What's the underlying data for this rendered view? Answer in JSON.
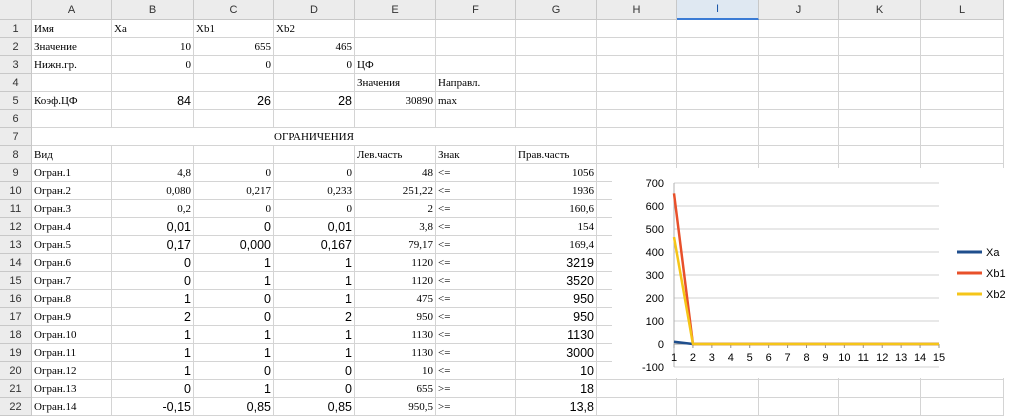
{
  "columns": [
    "A",
    "B",
    "C",
    "D",
    "E",
    "F",
    "G",
    "H",
    "I",
    "J",
    "K",
    "L"
  ],
  "selected_column": "I",
  "rows": [
    {
      "n": "1",
      "cells": [
        {
          "col": 0,
          "v": "Имя"
        },
        {
          "col": 1,
          "v": "Xa"
        },
        {
          "col": 2,
          "v": "Xb1"
        },
        {
          "col": 3,
          "v": "Xb2"
        }
      ]
    },
    {
      "n": "2",
      "cells": [
        {
          "col": 0,
          "v": "Значение"
        },
        {
          "col": 1,
          "v": "10",
          "a": "r"
        },
        {
          "col": 2,
          "v": "655",
          "a": "r"
        },
        {
          "col": 3,
          "v": "465",
          "a": "r"
        }
      ]
    },
    {
      "n": "3",
      "cells": [
        {
          "col": 0,
          "v": "Нижн.гр."
        },
        {
          "col": 1,
          "v": "0",
          "a": "r"
        },
        {
          "col": 2,
          "v": "0",
          "a": "r"
        },
        {
          "col": 3,
          "v": "0",
          "a": "r"
        },
        {
          "col": 4,
          "v": "ЦФ"
        }
      ]
    },
    {
      "n": "4",
      "cells": [
        {
          "col": 4,
          "v": "Значения"
        },
        {
          "col": 5,
          "v": "Направл."
        }
      ]
    },
    {
      "n": "5",
      "cells": [
        {
          "col": 0,
          "v": "Коэф.ЦФ"
        },
        {
          "col": 1,
          "v": "84",
          "a": "r",
          "big": true
        },
        {
          "col": 2,
          "v": "26",
          "a": "r",
          "big": true
        },
        {
          "col": 3,
          "v": "28",
          "a": "r",
          "big": true
        },
        {
          "col": 4,
          "v": "30890",
          "a": "r"
        },
        {
          "col": 5,
          "v": "max"
        }
      ]
    },
    {
      "n": "6",
      "cells": []
    },
    {
      "n": "7",
      "cells": [
        {
          "col": 0,
          "span": 7,
          "v": "ОГРАНИЧЕНИЯ",
          "a": "c"
        }
      ]
    },
    {
      "n": "8",
      "cells": [
        {
          "col": 0,
          "v": "Вид"
        },
        {
          "col": 4,
          "v": "Лев.часть"
        },
        {
          "col": 5,
          "v": "Знак"
        },
        {
          "col": 6,
          "v": "Прав.часть"
        }
      ]
    },
    {
      "n": "9",
      "cells": [
        {
          "col": 0,
          "v": "Огран.1"
        },
        {
          "col": 1,
          "v": "4,8",
          "a": "r"
        },
        {
          "col": 2,
          "v": "0",
          "a": "r"
        },
        {
          "col": 3,
          "v": "0",
          "a": "r"
        },
        {
          "col": 4,
          "v": "48",
          "a": "r"
        },
        {
          "col": 5,
          "v": "<="
        },
        {
          "col": 6,
          "v": "1056",
          "a": "r"
        }
      ]
    },
    {
      "n": "10",
      "cells": [
        {
          "col": 0,
          "v": "Огран.2"
        },
        {
          "col": 1,
          "v": "0,080",
          "a": "r"
        },
        {
          "col": 2,
          "v": "0,217",
          "a": "r"
        },
        {
          "col": 3,
          "v": "0,233",
          "a": "r"
        },
        {
          "col": 4,
          "v": "251,22",
          "a": "r"
        },
        {
          "col": 5,
          "v": "<="
        },
        {
          "col": 6,
          "v": "1936",
          "a": "r"
        }
      ]
    },
    {
      "n": "11",
      "cells": [
        {
          "col": 0,
          "v": "Огран.3"
        },
        {
          "col": 1,
          "v": "0,2",
          "a": "r"
        },
        {
          "col": 2,
          "v": "0",
          "a": "r"
        },
        {
          "col": 3,
          "v": "0",
          "a": "r"
        },
        {
          "col": 4,
          "v": "2",
          "a": "r"
        },
        {
          "col": 5,
          "v": "<="
        },
        {
          "col": 6,
          "v": "160,6",
          "a": "r"
        }
      ]
    },
    {
      "n": "12",
      "cells": [
        {
          "col": 0,
          "v": "Огран.4"
        },
        {
          "col": 1,
          "v": "0,01",
          "a": "r",
          "big": true
        },
        {
          "col": 2,
          "v": "0",
          "a": "r",
          "big": true
        },
        {
          "col": 3,
          "v": "0,01",
          "a": "r",
          "big": true
        },
        {
          "col": 4,
          "v": "3,8",
          "a": "r"
        },
        {
          "col": 5,
          "v": "<="
        },
        {
          "col": 6,
          "v": "154",
          "a": "r"
        }
      ]
    },
    {
      "n": "13",
      "cells": [
        {
          "col": 0,
          "v": "Огран.5"
        },
        {
          "col": 1,
          "v": "0,17",
          "a": "r",
          "big": true
        },
        {
          "col": 2,
          "v": "0,000",
          "a": "r",
          "big": true
        },
        {
          "col": 3,
          "v": "0,167",
          "a": "r",
          "big": true
        },
        {
          "col": 4,
          "v": "79,17",
          "a": "r"
        },
        {
          "col": 5,
          "v": "<="
        },
        {
          "col": 6,
          "v": "169,4",
          "a": "r"
        }
      ]
    },
    {
      "n": "14",
      "cells": [
        {
          "col": 0,
          "v": "Огран.6"
        },
        {
          "col": 1,
          "v": "0",
          "a": "r",
          "big": true
        },
        {
          "col": 2,
          "v": "1",
          "a": "r",
          "big": true
        },
        {
          "col": 3,
          "v": "1",
          "a": "r",
          "big": true
        },
        {
          "col": 4,
          "v": "1120",
          "a": "r"
        },
        {
          "col": 5,
          "v": "<="
        },
        {
          "col": 6,
          "v": "3219",
          "a": "r",
          "big": true
        }
      ]
    },
    {
      "n": "15",
      "cells": [
        {
          "col": 0,
          "v": "Огран.7"
        },
        {
          "col": 1,
          "v": "0",
          "a": "r",
          "big": true
        },
        {
          "col": 2,
          "v": "1",
          "a": "r",
          "big": true
        },
        {
          "col": 3,
          "v": "1",
          "a": "r",
          "big": true
        },
        {
          "col": 4,
          "v": "1120",
          "a": "r"
        },
        {
          "col": 5,
          "v": "<="
        },
        {
          "col": 6,
          "v": "3520",
          "a": "r",
          "big": true
        }
      ]
    },
    {
      "n": "16",
      "cells": [
        {
          "col": 0,
          "v": "Огран.8"
        },
        {
          "col": 1,
          "v": "1",
          "a": "r",
          "big": true
        },
        {
          "col": 2,
          "v": "0",
          "a": "r",
          "big": true
        },
        {
          "col": 3,
          "v": "1",
          "a": "r",
          "big": true
        },
        {
          "col": 4,
          "v": "475",
          "a": "r"
        },
        {
          "col": 5,
          "v": "<="
        },
        {
          "col": 6,
          "v": "950",
          "a": "r",
          "big": true
        }
      ]
    },
    {
      "n": "17",
      "cells": [
        {
          "col": 0,
          "v": "Огран.9"
        },
        {
          "col": 1,
          "v": "2",
          "a": "r",
          "big": true
        },
        {
          "col": 2,
          "v": "0",
          "a": "r",
          "big": true
        },
        {
          "col": 3,
          "v": "2",
          "a": "r",
          "big": true
        },
        {
          "col": 4,
          "v": "950",
          "a": "r"
        },
        {
          "col": 5,
          "v": "<="
        },
        {
          "col": 6,
          "v": "950",
          "a": "r",
          "big": true
        }
      ]
    },
    {
      "n": "18",
      "cells": [
        {
          "col": 0,
          "v": "Огран.10"
        },
        {
          "col": 1,
          "v": "1",
          "a": "r",
          "big": true
        },
        {
          "col": 2,
          "v": "1",
          "a": "r",
          "big": true
        },
        {
          "col": 3,
          "v": "1",
          "a": "r",
          "big": true
        },
        {
          "col": 4,
          "v": "1130",
          "a": "r"
        },
        {
          "col": 5,
          "v": "<="
        },
        {
          "col": 6,
          "v": "1130",
          "a": "r",
          "big": true
        }
      ]
    },
    {
      "n": "19",
      "cells": [
        {
          "col": 0,
          "v": "Огран.11"
        },
        {
          "col": 1,
          "v": "1",
          "a": "r",
          "big": true
        },
        {
          "col": 2,
          "v": "1",
          "a": "r",
          "big": true
        },
        {
          "col": 3,
          "v": "1",
          "a": "r",
          "big": true
        },
        {
          "col": 4,
          "v": "1130",
          "a": "r"
        },
        {
          "col": 5,
          "v": "<="
        },
        {
          "col": 6,
          "v": "3000",
          "a": "r",
          "big": true
        }
      ]
    },
    {
      "n": "20",
      "cells": [
        {
          "col": 0,
          "v": "Огран.12"
        },
        {
          "col": 1,
          "v": "1",
          "a": "r",
          "big": true
        },
        {
          "col": 2,
          "v": "0",
          "a": "r",
          "big": true
        },
        {
          "col": 3,
          "v": "0",
          "a": "r",
          "big": true
        },
        {
          "col": 4,
          "v": "10",
          "a": "r"
        },
        {
          "col": 5,
          "v": "<="
        },
        {
          "col": 6,
          "v": "10",
          "a": "r",
          "big": true
        }
      ]
    },
    {
      "n": "21",
      "cells": [
        {
          "col": 0,
          "v": "Огран.13"
        },
        {
          "col": 1,
          "v": "0",
          "a": "r",
          "big": true
        },
        {
          "col": 2,
          "v": "1",
          "a": "r",
          "big": true
        },
        {
          "col": 3,
          "v": "0",
          "a": "r",
          "big": true
        },
        {
          "col": 4,
          "v": "655",
          "a": "r"
        },
        {
          "col": 5,
          "v": ">="
        },
        {
          "col": 6,
          "v": "18",
          "a": "r",
          "big": true
        }
      ]
    },
    {
      "n": "22",
      "cells": [
        {
          "col": 0,
          "v": "Огран.14"
        },
        {
          "col": 1,
          "v": "-0,15",
          "a": "r",
          "big": true
        },
        {
          "col": 2,
          "v": "0,85",
          "a": "r",
          "big": true
        },
        {
          "col": 3,
          "v": "0,85",
          "a": "r",
          "big": true
        },
        {
          "col": 4,
          "v": "950,5",
          "a": "r"
        },
        {
          "col": 5,
          "v": ">="
        },
        {
          "col": 6,
          "v": "13,8",
          "a": "r",
          "big": true
        }
      ]
    }
  ],
  "chart_data": {
    "type": "line",
    "x": [
      1,
      2,
      3,
      4,
      5,
      6,
      7,
      8,
      9,
      10,
      11,
      12,
      13,
      14,
      15
    ],
    "x_tick_labels": [
      "1",
      "2",
      "3",
      "4",
      "5",
      "6",
      "7",
      "8",
      "9",
      "10",
      "11",
      "12",
      "13",
      "14",
      "15"
    ],
    "ylim": [
      -100,
      700
    ],
    "y_ticks": [
      700,
      600,
      500,
      400,
      300,
      200,
      100,
      0,
      -100
    ],
    "grid": true,
    "legend": "right",
    "series": [
      {
        "name": "Xa",
        "color": "#1f4e8c",
        "values": [
          10,
          0,
          0,
          0,
          0,
          0,
          0,
          0,
          0,
          0,
          0,
          0,
          0,
          0,
          0
        ]
      },
      {
        "name": "Xb1",
        "color": "#e8502a",
        "values": [
          655,
          0,
          0,
          0,
          0,
          0,
          0,
          0,
          0,
          0,
          0,
          0,
          0,
          0,
          0
        ]
      },
      {
        "name": "Xb2",
        "color": "#f5c518",
        "values": [
          465,
          0,
          0,
          0,
          0,
          0,
          0,
          0,
          0,
          0,
          0,
          0,
          0,
          0,
          0
        ]
      }
    ]
  }
}
